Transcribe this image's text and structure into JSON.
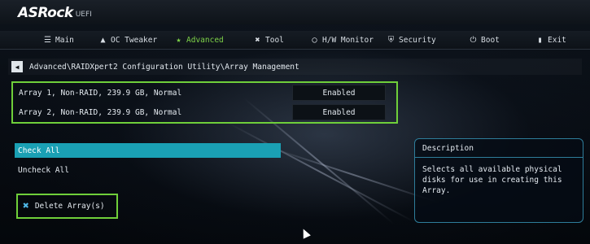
{
  "brand": {
    "name": "ASRock",
    "suffix": "UEFI"
  },
  "menu": [
    {
      "label": "Main",
      "icon": "list-icon",
      "active": false
    },
    {
      "label": "OC Tweaker",
      "icon": "rocket-icon",
      "active": false
    },
    {
      "label": "Advanced",
      "icon": "star-icon",
      "active": true
    },
    {
      "label": "Tool",
      "icon": "tools-icon",
      "active": false
    },
    {
      "label": "H/W Monitor",
      "icon": "monitor-icon",
      "active": false
    },
    {
      "label": "Security",
      "icon": "shield-icon",
      "active": false
    },
    {
      "label": "Boot",
      "icon": "power-icon",
      "active": false
    },
    {
      "label": "Exit",
      "icon": "door-icon",
      "active": false
    }
  ],
  "breadcrumb": "Advanced\\RAIDXpert2 Configuration Utility\\Array Management",
  "arrays": [
    {
      "label": "Array 1, Non-RAID, 239.9 GB, Normal",
      "value": "Enabled"
    },
    {
      "label": "Array 2, Non-RAID, 239.9 GB, Normal",
      "value": "Enabled"
    }
  ],
  "options": {
    "check_all": "Check All",
    "uncheck_all": "Uncheck All",
    "delete_array": "Delete Array(s)"
  },
  "description": {
    "title": "Description",
    "text": "Selects all available physical disks for use in creating this Array."
  },
  "colors": {
    "accent_green": "#6fcf3a",
    "selection": "#1aa0b4"
  }
}
